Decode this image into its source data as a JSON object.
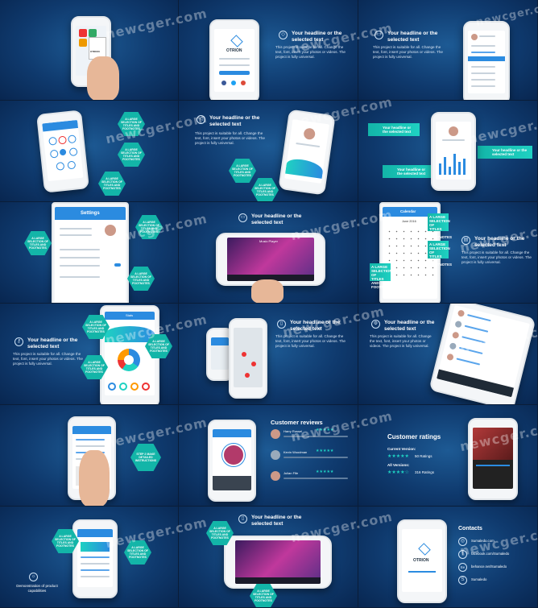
{
  "watermark": "newcger.com",
  "headline": "Your headline or the selected text",
  "body_text": "This project is suitable for all. Change the text, font, insert your photos or videos. The project is fully universal.",
  "brand": "OTRION",
  "hex_label": "A LARGE SELECTION OF TITLES AND FOOTNOTES",
  "settings_title": "Settings",
  "stats_title": "Stats",
  "calendar_title": "Calendar",
  "calendar_month": "June 2016",
  "music_title": "Music Player",
  "step_label": "STEP 2 MAKE DETAILED INSTRUCTIONS",
  "reviews": {
    "title": "Customer reviews",
    "names": [
      "Harry Russel",
      "Kevin Woodman",
      "Julian Fife"
    ]
  },
  "ratings": {
    "title": "Customer ratings",
    "current_label": "Current Version:",
    "current_count": "50 Ratings",
    "all_label": "All Versions:",
    "all_count": "316 Ratings"
  },
  "demo_caption": "Demonstration of product capabilities",
  "contacts": {
    "title": "Contacts",
    "items": [
      "Sumaledo.com",
      "facebook.com/Sumaledo",
      "behance.net/Sumaledo",
      "Sumaledo"
    ]
  },
  "colors": {
    "accent": "#13b5a8",
    "blue": "#2b8be0",
    "bg": "#0f3a6e"
  }
}
